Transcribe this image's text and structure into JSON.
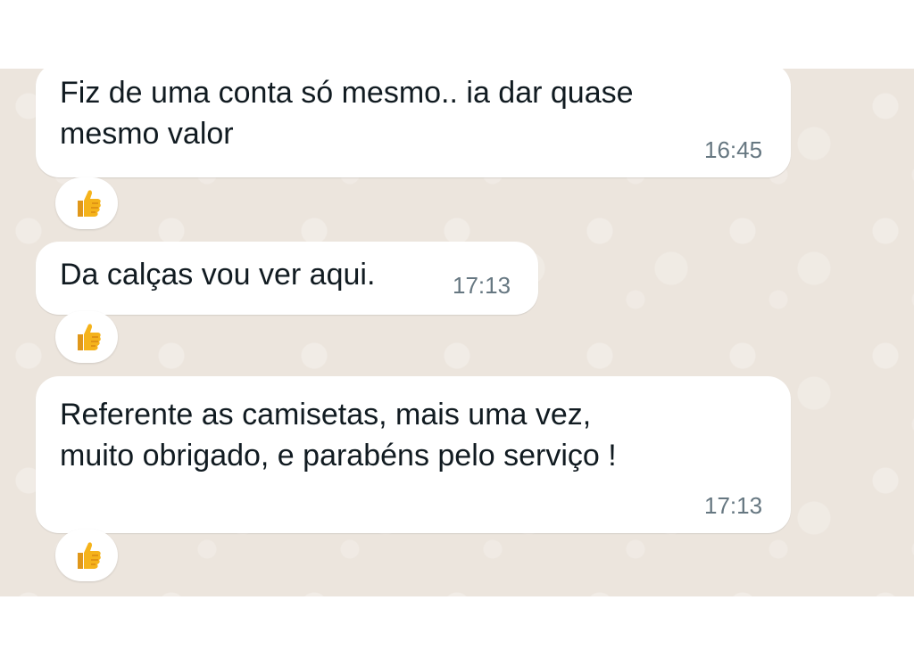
{
  "messages": [
    {
      "text": "Fiz de uma conta só mesmo.. ia dar quase\nmesmo valor",
      "time": "16:45",
      "reaction": "thumbs-up-icon"
    },
    {
      "text": "Da calças vou ver aqui.",
      "time": "17:13",
      "reaction": "thumbs-up-icon"
    },
    {
      "text": "Referente as camisetas, mais uma vez,\nmuito obrigado, e parabéns pelo serviço !",
      "time": "17:13",
      "reaction": "thumbs-up-icon"
    }
  ],
  "colors": {
    "chat_background": "#ece5dd",
    "bubble": "#ffffff",
    "timestamp": "#667781",
    "thumbs_up": "#f5b31b"
  }
}
